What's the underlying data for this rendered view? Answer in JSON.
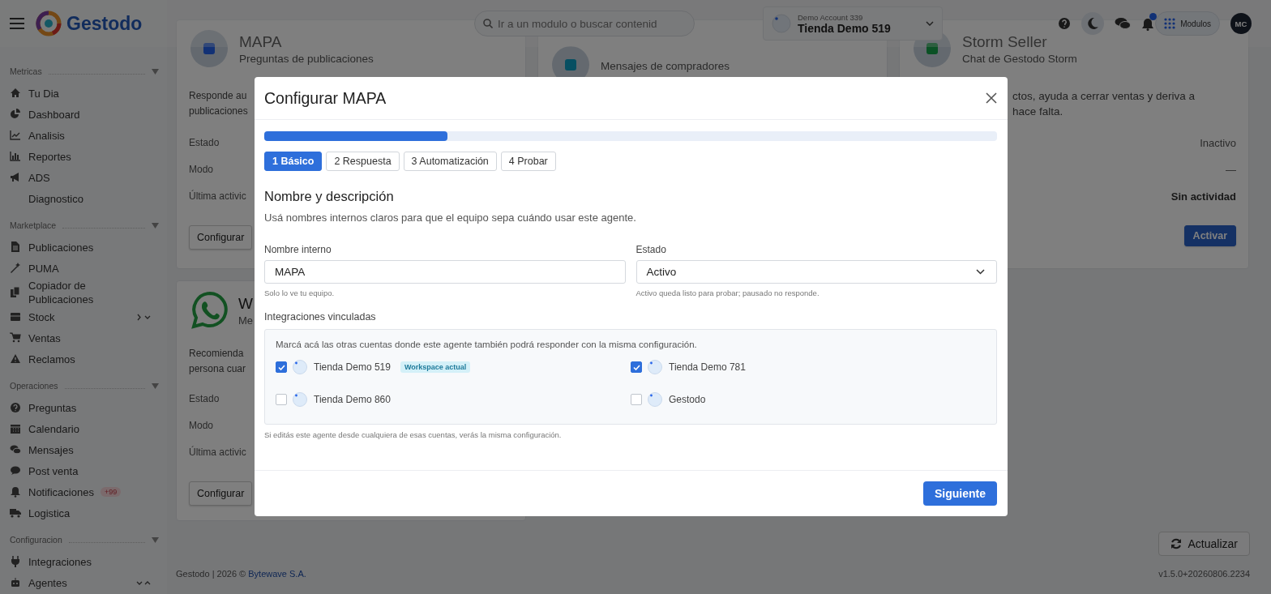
{
  "topbar": {
    "brand": "Gestodo",
    "search": {
      "placeholder": "Ir a un modulo o buscar contenid"
    },
    "account": {
      "label": "Demo Account 339",
      "name": "Tienda Demo 519"
    },
    "modules_button": "Modulos",
    "avatar": "MC"
  },
  "sidebar": {
    "sections": [
      {
        "title": "Metricas",
        "items": [
          {
            "label": "Tu Dia"
          },
          {
            "label": "Dashboard"
          },
          {
            "label": "Analisis"
          },
          {
            "label": "Reportes"
          },
          {
            "label": "ADS"
          },
          {
            "label": "Diagnostico"
          }
        ]
      },
      {
        "title": "Marketplace",
        "items": [
          {
            "label": "Publicaciones"
          },
          {
            "label": "PUMA"
          },
          {
            "label": "Copiador de Publicaciones"
          },
          {
            "label": "Stock",
            "expanded": false
          },
          {
            "label": "Ventas"
          },
          {
            "label": "Reclamos"
          }
        ]
      },
      {
        "title": "Operaciones",
        "items": [
          {
            "label": "Preguntas"
          },
          {
            "label": "Calendario"
          },
          {
            "label": "Mensajes"
          },
          {
            "label": "Post venta"
          },
          {
            "label": "Notificaciones",
            "badge": "+99"
          },
          {
            "label": "Logistica"
          }
        ]
      },
      {
        "title": "Configuracion",
        "items": [
          {
            "label": "Integraciones"
          },
          {
            "label": "Agentes",
            "expanded": true
          }
        ]
      }
    ]
  },
  "cards": [
    {
      "title": "MAPA",
      "subtitle": "Preguntas de publicaciones",
      "description": [
        "Responde au",
        "publicaciones"
      ],
      "rows": [
        {
          "label": "Estado"
        },
        {
          "label": "Modo"
        },
        {
          "label": "Última activic"
        }
      ],
      "button": {
        "label": "Configurar",
        "primary": false
      }
    },
    {
      "subtitle": "Mensajes de compradores"
    },
    {
      "title": "Storm Seller",
      "subtitle": "Chat de Gestodo Storm",
      "description": [
        "ctos, ayuda a cerrar ventas y deriva a",
        "hace falta."
      ],
      "rows": [
        {
          "value": "Inactivo"
        },
        {
          "value": "—"
        },
        {
          "value": "Sin actividad"
        }
      ],
      "button": {
        "label": "Activar",
        "primary": true
      }
    },
    {
      "title": "W",
      "subtitle": "Me",
      "description": [
        "Recomienda",
        "persona cuar"
      ],
      "rows": [
        {
          "label": "Estado"
        },
        {
          "label": "Modo"
        },
        {
          "label": "Última activic"
        }
      ],
      "button": {
        "label": "Configurar",
        "primary": false
      }
    }
  ],
  "footer": {
    "text": "Gestodo | 2026 © ",
    "link": "Bytewave S.A.",
    "version": "v1.5.0+20260806.2234",
    "refresh_button": "Actualizar"
  },
  "modal": {
    "title": "Configurar MAPA",
    "progress": {
      "level": 0.25
    },
    "steps": [
      {
        "label": "1 Básico",
        "selected": true
      },
      {
        "label": "2 Respuesta",
        "selected": false
      },
      {
        "label": "3 Automatización",
        "selected": false
      },
      {
        "label": "4 Probar",
        "selected": false
      }
    ],
    "heading": "Nombre y descripción",
    "intro": "Usá nombres internos claros para que el equipo sepa cuándo usar este agente.",
    "fields": [
      {
        "kind": "input",
        "label": "Nombre interno",
        "value": "MAPA",
        "hint": "Solo lo ve tu equipo."
      },
      {
        "kind": "select",
        "label": "Estado",
        "value": "Activo",
        "hint": "Activo queda listo para probar; pausado no responde."
      }
    ],
    "integrations": {
      "label": "Integraciones vinculadas",
      "intro": "Marcá acá las otras cuentas donde este agente también podrá responder con la misma configuración.",
      "items": [
        {
          "name": "Tienda Demo 519",
          "checked": true,
          "badge": "Workspace actual"
        },
        {
          "name": "Tienda Demo 781",
          "checked": true
        },
        {
          "name": "Tienda Demo 860",
          "checked": false
        },
        {
          "name": "Gestodo",
          "checked": false
        }
      ],
      "note": "Si editás este agente desde cualquiera de esas cuentas, verás la misma configuración."
    },
    "next_button": "Siguiente"
  }
}
